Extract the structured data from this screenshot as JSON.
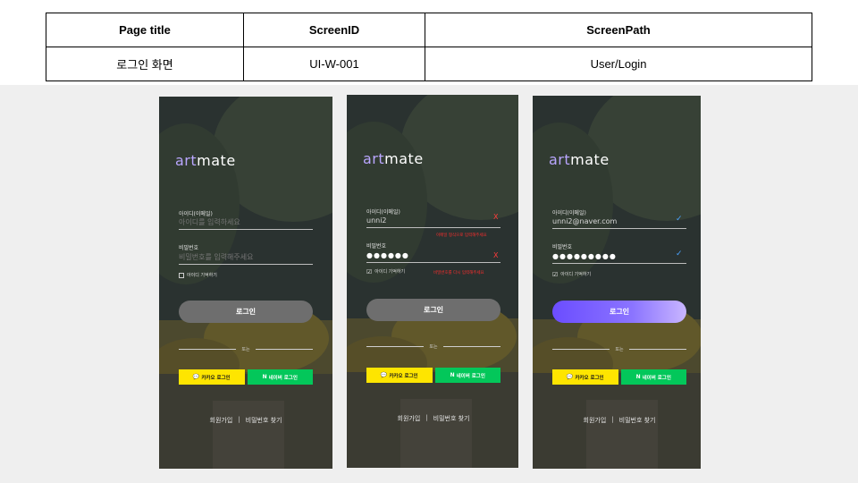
{
  "spec": {
    "headers": [
      "Page title",
      "ScreenID",
      "ScreenPath"
    ],
    "values": [
      "로그인 화면",
      "UI-W-001",
      "User/Login"
    ]
  },
  "app": {
    "logo_part1": "art",
    "logo_part2": "mate"
  },
  "screens": [
    {
      "id_label": "아이디(이메일)",
      "id_value": "",
      "id_placeholder": "아이디를 입력하세요",
      "pw_label": "비밀번호",
      "pw_value": "",
      "pw_placeholder": "비밀번호를 입력해주세요",
      "remember_label": "아이디 기억하기",
      "remember_checked": false,
      "login_label": "로그인",
      "divider_label": "또는",
      "kakao_label": "카카오 로그인",
      "naver_label": "네이버 로그인",
      "signup_label": "회원가입",
      "find_pw_label": "비밀번호 찾기",
      "separator": "|"
    },
    {
      "id_label": "아이디(이메일)",
      "id_value": "unni2",
      "id_error": "이메일 형식으로 입력해주세요",
      "pw_label": "비밀번호",
      "pw_value": "●●●●●●",
      "pw_error": "비밀번호를 다시 입력해주세요",
      "error_icon": "X",
      "remember_label": "아이디 기억하기",
      "remember_checked": true,
      "login_label": "로그인",
      "divider_label": "또는",
      "kakao_label": "카카오 로그인",
      "naver_label": "네이버 로그인",
      "signup_label": "회원가입",
      "find_pw_label": "비밀번호 찾기",
      "separator": "|"
    },
    {
      "id_label": "아이디(이메일)",
      "id_value": "unni2@naver.com",
      "pw_label": "비밀번호",
      "pw_value": "●●●●●●●●●",
      "remember_label": "아이디 기억하기",
      "remember_checked": true,
      "login_label": "로그인",
      "divider_label": "또는",
      "kakao_label": "카카오 로그인",
      "naver_label": "네이버 로그인",
      "signup_label": "회원가입",
      "find_pw_label": "비밀번호 찾기",
      "separator": "|"
    }
  ],
  "colors": {
    "logo_accent": "#b9a6ff",
    "login_active": "#6b4dff",
    "login_disabled": "#6e6e6e",
    "kakao": "#fee500",
    "naver": "#03c75a",
    "error": "#ff2d2d",
    "valid_check": "#4aa3ff"
  },
  "icons": {
    "kakao": "speech-bubble-icon",
    "naver": "naver-n-icon",
    "valid": "checkmark-icon",
    "error": "x-icon"
  }
}
